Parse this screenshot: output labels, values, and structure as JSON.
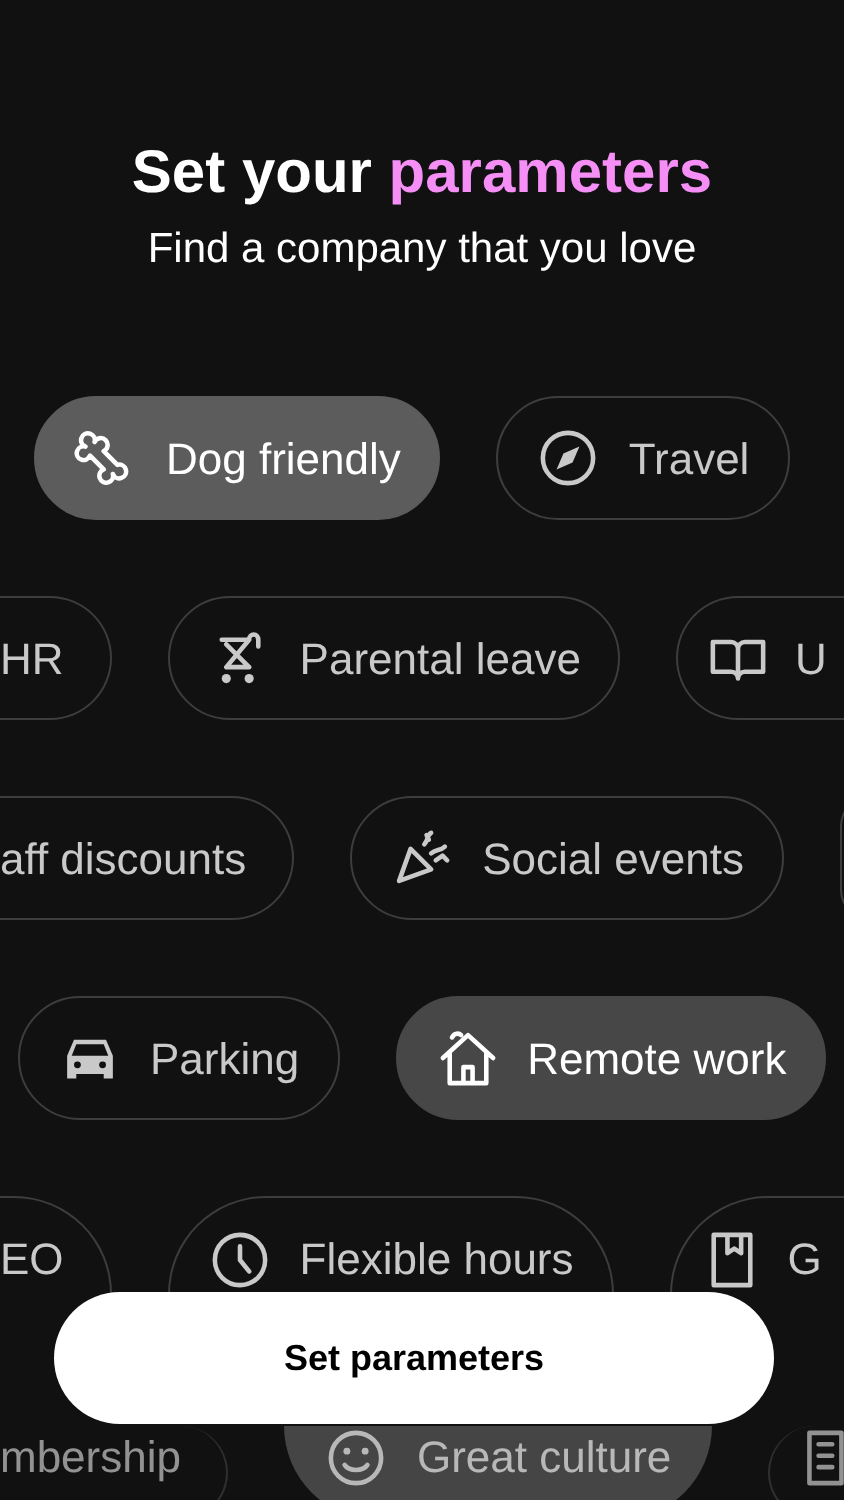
{
  "header": {
    "title": "Set your ",
    "title_highlight": "parameters",
    "subtitle": "Find a company that you love"
  },
  "rows": [
    {
      "chips": [
        {
          "kind": "full",
          "label": "Dog friendly",
          "selected": true
        },
        {
          "kind": "full",
          "label": "Travel",
          "selected": false
        }
      ]
    },
    {
      "chips": [
        {
          "kind": "cut_left",
          "label": "HR",
          "selected": false
        },
        {
          "kind": "full",
          "label": "Parental leave",
          "selected": false
        },
        {
          "kind": "cut_right",
          "label": "U",
          "selected": false
        }
      ]
    },
    {
      "chips": [
        {
          "kind": "cut_left",
          "label": "aff discounts",
          "selected": false
        },
        {
          "kind": "full",
          "label": "Social events",
          "selected": false
        },
        {
          "kind": "cut_right",
          "selected": false
        }
      ]
    },
    {
      "chips": [
        {
          "kind": "full",
          "label": "Parking",
          "selected": false
        },
        {
          "kind": "full",
          "label": "Remote work",
          "selected": true
        }
      ]
    },
    {
      "chips": [
        {
          "kind": "cut_left",
          "label": "EO",
          "selected": false
        },
        {
          "kind": "full",
          "label": "Flexible hours",
          "selected": false
        },
        {
          "kind": "cut_right",
          "label": "G",
          "selected": false
        }
      ]
    },
    {
      "chips": [
        {
          "kind": "cut_left",
          "label": "mbership",
          "selected": false
        },
        {
          "kind": "full",
          "label": "Great culture",
          "selected": true
        },
        {
          "kind": "cut_right",
          "selected": false
        }
      ]
    }
  ],
  "primary_button": {
    "label": "Set parameters"
  }
}
